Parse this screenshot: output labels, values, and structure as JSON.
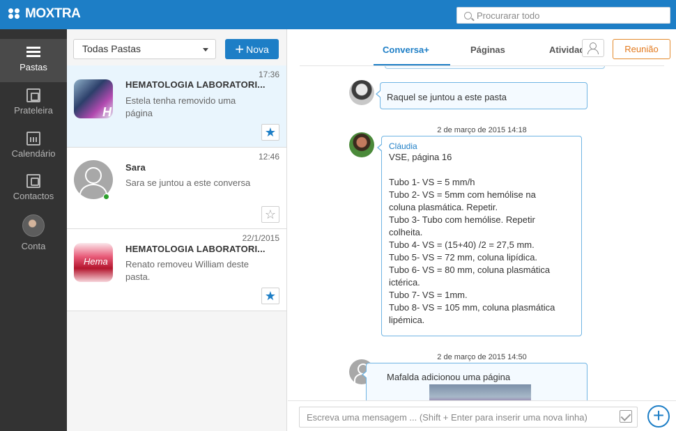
{
  "app": {
    "logo_text": "MOXTRA"
  },
  "search": {
    "placeholder": "Procurarar todo"
  },
  "sidebar": {
    "items": [
      {
        "label": "Pastas",
        "icon": "list-icon"
      },
      {
        "label": "Prateleira",
        "icon": "shelf-icon"
      },
      {
        "label": "Calendário",
        "icon": "calendar-icon"
      },
      {
        "label": "Contactos",
        "icon": "contacts-icon"
      },
      {
        "label": "Conta",
        "icon": "avatar"
      }
    ]
  },
  "folders": {
    "filter": "Todas Pastas",
    "new_label": "Nova",
    "cards": [
      {
        "time": "17:36",
        "title": "HEMATOLOGIA LABORATORI...",
        "desc": "Estela tenha removido uma página",
        "starred": true
      },
      {
        "time": "12:46",
        "title": "Sara",
        "desc": "Sara se juntou a este conversa",
        "starred": false
      },
      {
        "time": "22/1/2015",
        "title": "HEMATOLOGIA LABORATORI...",
        "desc": "Renato removeu William deste pasta.",
        "starred": true
      }
    ]
  },
  "chat": {
    "tabs": [
      "Conversa+",
      "Páginas",
      "Atividades"
    ],
    "meeting_label": "Reunião",
    "messages": {
      "joined": "Raquel se juntou a este pasta",
      "stamp1": "2 de março de 2015 14:18",
      "claudia": {
        "sender": "Cláudia",
        "lines": [
          "VSE, página 16",
          "",
          "Tubo 1- VS = 5 mm/h",
          "Tubo 2- VS = 5mm com hemólise na",
          "coluna plasmática. Repetir.",
          "Tubo 3- Tubo com hemólise. Repetir",
          "colheita.",
          "Tubo 4- VS = (15+40) /2 = 27,5 mm.",
          "Tubo 5- VS = 72 mm, coluna lipídica.",
          "Tubo 6- VS = 80 mm, coluna plasmática",
          "ictérica.",
          "Tubo 7- VS = 1mm.",
          "Tubo 8- VS = 105 mm, coluna plasmática",
          "lipémica."
        ]
      },
      "stamp2": "2 de março de 2015 14:50",
      "mafalda": "Mafalda adicionou uma página"
    },
    "composer_placeholder": "Escreva uma mensagem ... (Shift + Enter para inserir uma nova linha)"
  },
  "colors": {
    "brand": "#1d7ec6",
    "sidebar": "#333333",
    "meeting": "#e37a1e"
  }
}
